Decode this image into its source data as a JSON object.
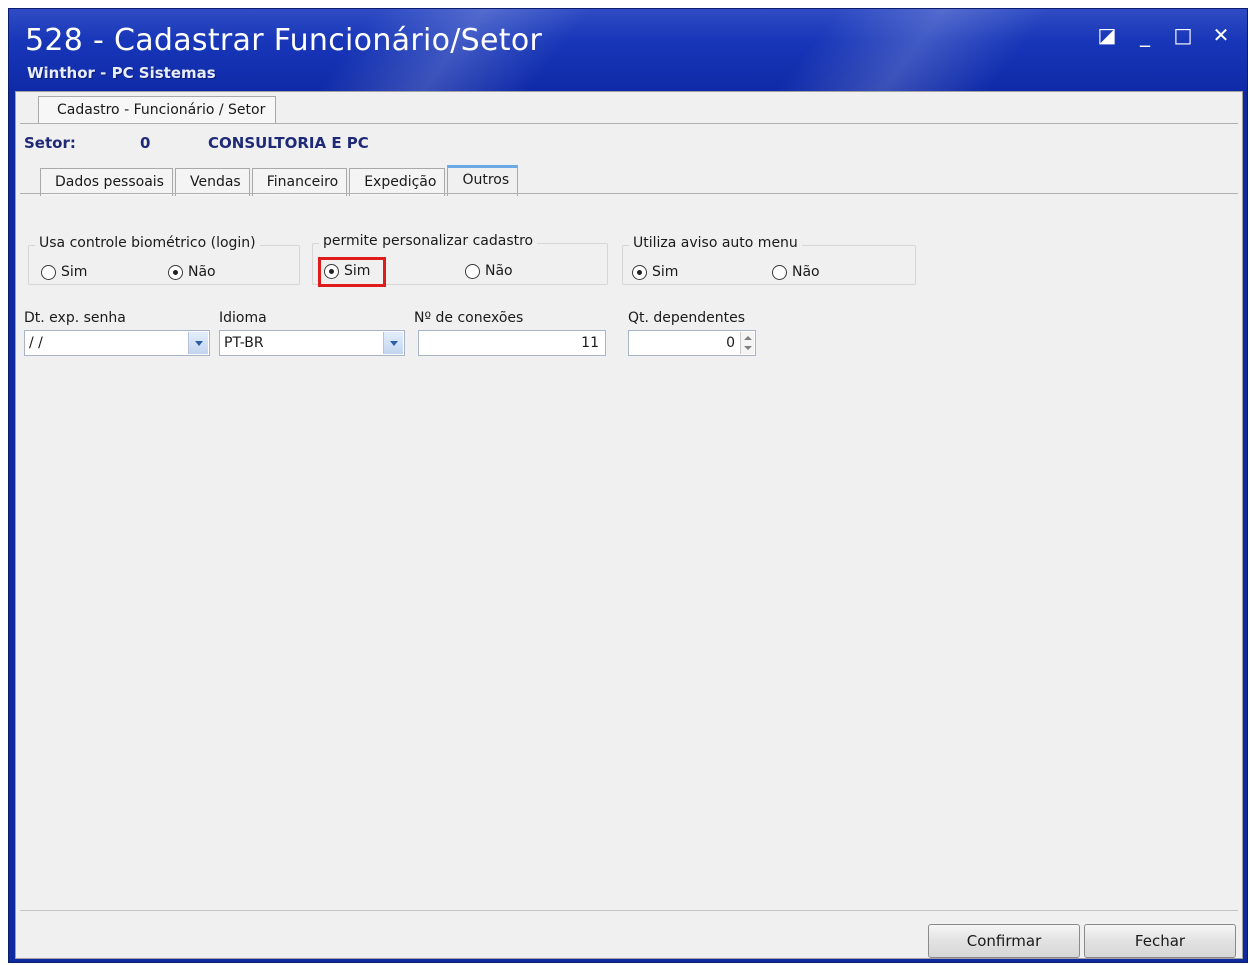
{
  "window": {
    "title": "528 - Cadastrar Funcionário/Setor",
    "subtitle": "Winthor - PC Sistemas",
    "controls": [
      "◪",
      "_",
      "□",
      "✕"
    ]
  },
  "outer_tab": {
    "label": "Cadastro - Funcionário / Setor"
  },
  "setor": {
    "label": "Setor:",
    "code": "0",
    "name": "CONSULTORIA E PC"
  },
  "tabs": [
    {
      "label": "Dados pessoais",
      "active": false
    },
    {
      "label": "Vendas",
      "active": false
    },
    {
      "label": "Financeiro",
      "active": false
    },
    {
      "label": "Expedição",
      "active": false
    },
    {
      "label": "Outros",
      "active": true
    }
  ],
  "groups": {
    "biometrico": {
      "title": "Usa controle biométrico (login)",
      "sim": "Sim",
      "nao": "Não",
      "selected": "Não"
    },
    "personalizar": {
      "title": "permite personalizar cadastro",
      "sim": "Sim",
      "nao": "Não",
      "selected": "Sim"
    },
    "aviso_menu": {
      "title": "Utiliza aviso auto menu",
      "sim": "Sim",
      "nao": "Não",
      "selected": "Sim"
    }
  },
  "fields": {
    "dt_exp_senha": {
      "label": "Dt. exp. senha",
      "value": "/ /"
    },
    "idioma": {
      "label": "Idioma",
      "value": "PT-BR"
    },
    "conexoes": {
      "label": "Nº de conexões",
      "value": "11"
    },
    "dependentes": {
      "label": "Qt. dependentes",
      "value": "0"
    }
  },
  "buttons": {
    "confirmar": "Confirmar",
    "fechar": "Fechar"
  }
}
